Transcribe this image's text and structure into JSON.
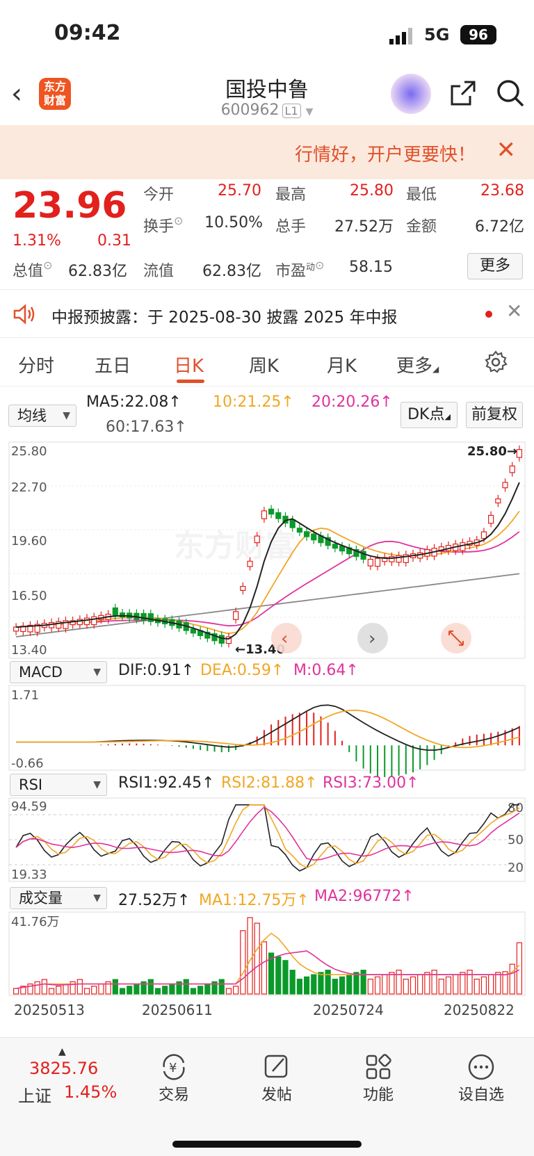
{
  "status": {
    "time": "09:42",
    "network": "5G",
    "battery": "96"
  },
  "nav": {
    "title": "国投中鲁",
    "code": "600962",
    "level_badge": "L1",
    "logo_text": "东方财富"
  },
  "promo": {
    "text": "行情好，开户更要快！"
  },
  "quote": {
    "price": "23.96",
    "pct": "1.31%",
    "change": "0.31",
    "open_label": "今开",
    "open": "25.70",
    "high_label": "最高",
    "high": "25.80",
    "low_label": "最低",
    "low": "23.68",
    "turnover_label": "换手",
    "turnover": "10.50%",
    "volume_label": "总手",
    "volume": "27.52万",
    "amount_label": "金额",
    "amount": "6.72亿",
    "total_value_label": "总值",
    "total_value": "62.83亿",
    "float_value_label": "流值",
    "float_value": "62.83亿",
    "pe_label": "市盈",
    "pe_sup": "动",
    "pe": "58.15",
    "more": "更多"
  },
  "notice": {
    "text": "中报预披露：于 2025-08-30 披露 2025 年中报"
  },
  "tabs": [
    "分时",
    "五日",
    "日K",
    "周K",
    "月K",
    "更多"
  ],
  "active_tab": "日K",
  "ma": {
    "selector": "均线",
    "ma5": "MA5:22.08↑",
    "ma10": "10:21.25↑",
    "ma20": "20:20.26↑",
    "ma60": "60:17.63↑",
    "dk": "DK点",
    "adjust": "前复权"
  },
  "kline": {
    "y_labels": [
      "25.80",
      "22.70",
      "19.60",
      "16.50",
      "13.40"
    ],
    "max_label": "25.80→",
    "min_label": "←13.40",
    "watermark": "东方财富"
  },
  "macd": {
    "selector": "MACD",
    "dif": "DIF:0.91↑",
    "dea": "DEA:0.59↑",
    "m": "M:0.64↑",
    "y_top": "1.71",
    "y_bottom": "-0.66"
  },
  "rsi": {
    "selector": "RSI",
    "rsi1": "RSI1:92.45↑",
    "rsi2": "RSI2:81.88↑",
    "rsi3": "RSI3:73.00↑",
    "y_top": "94.59",
    "y_bottom": "19.33",
    "levels": [
      "80",
      "50",
      "20"
    ]
  },
  "volume": {
    "selector": "成交量",
    "vol": "27.52万↑",
    "ma1": "MA1:12.75万↑",
    "ma2": "MA2:96772↑",
    "y_top": "41.76万"
  },
  "dates": [
    "20250513",
    "20250611",
    "20250724",
    "20250822"
  ],
  "bottom": {
    "index_value": "3825.76",
    "index_name": "上证",
    "index_pct": "1.45%",
    "items": [
      "交易",
      "发帖",
      "功能",
      "设自选"
    ]
  },
  "colors": {
    "up": "#e2201c",
    "down": "#0a9a2a",
    "accent": "#e0502a",
    "ma5": "#222222",
    "ma10": "#f2a623",
    "ma20": "#e0329c",
    "ma60": "#888888"
  }
}
